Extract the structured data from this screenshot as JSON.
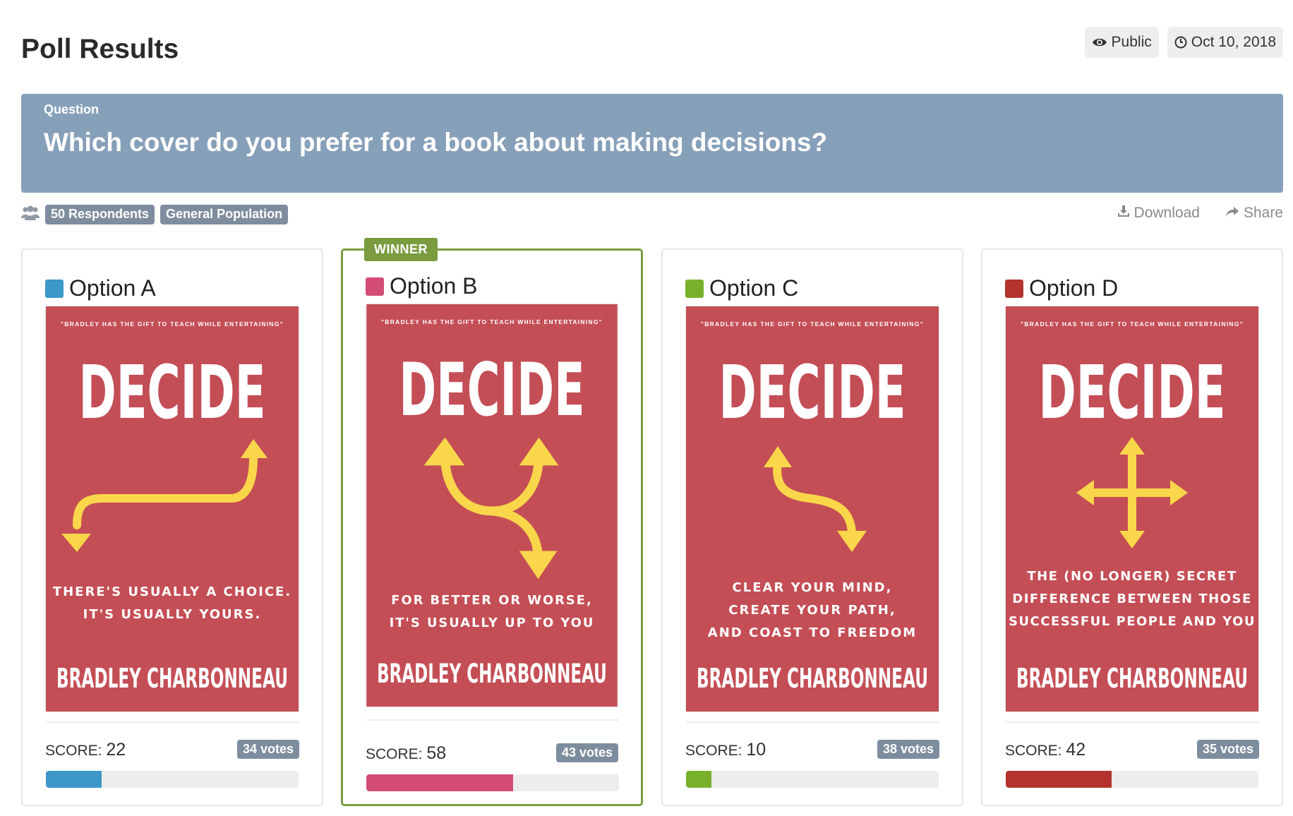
{
  "header": {
    "title": "Poll Results",
    "visibility": "Public",
    "date": "Oct 10, 2018"
  },
  "question": {
    "label": "Question",
    "text": "Which cover do you prefer for a book about making decisions?"
  },
  "meta": {
    "respondents": "50 Respondents",
    "audience": "General Population",
    "download": "Download",
    "share": "Share"
  },
  "score_label": "SCORE:",
  "winner_label": "WINNER",
  "options": [
    {
      "label": "Option A",
      "color": "#3d97c8",
      "score": 22,
      "score_fraction": 0.22,
      "votes": "34 votes",
      "winner": false,
      "cover": {
        "blurb": "\"BRADLEY HAS THE GIFT TO TEACH WHILE ENTERTAINING\"",
        "title": "DECIDE",
        "tagline": [
          "THERE'S USUALLY A CHOICE.",
          "IT'S USUALLY YOURS."
        ],
        "author": "BRADLEY CHARBONNEAU",
        "arrow": "curve-two-way-icon"
      }
    },
    {
      "label": "Option B",
      "color": "#d44d76",
      "score": 58,
      "score_fraction": 0.58,
      "votes": "43 votes",
      "winner": true,
      "cover": {
        "blurb": "\"BRADLEY HAS THE GIFT TO TEACH WHILE ENTERTAINING\"",
        "title": "DECIDE",
        "tagline": [
          "FOR BETTER OR WORSE,",
          "IT'S USUALLY UP TO YOU"
        ],
        "author": "BRADLEY CHARBONNEAU",
        "arrow": "three-way-fork-icon"
      }
    },
    {
      "label": "Option C",
      "color": "#78b02c",
      "score": 10,
      "score_fraction": 0.1,
      "votes": "38 votes",
      "winner": false,
      "cover": {
        "blurb": "\"BRADLEY HAS THE GIFT TO TEACH WHILE ENTERTAINING\"",
        "title": "DECIDE",
        "tagline": [
          "CLEAR YOUR MIND,",
          "CREATE YOUR PATH,",
          "AND COAST TO FREEDOM"
        ],
        "author": "BRADLEY CHARBONNEAU",
        "arrow": "s-curve-icon"
      }
    },
    {
      "label": "Option D",
      "color": "#b3342e",
      "score": 42,
      "score_fraction": 0.42,
      "votes": "35 votes",
      "winner": false,
      "cover": {
        "blurb": "\"BRADLEY HAS THE GIFT TO TEACH WHILE ENTERTAINING\"",
        "title": "DECIDE",
        "tagline": [
          "THE (NO LONGER) SECRET",
          "DIFFERENCE BETWEEN THOSE",
          "SUCCESSFUL PEOPLE AND YOU"
        ],
        "author": "BRADLEY CHARBONNEAU",
        "arrow": "four-way-cross-icon"
      }
    }
  ],
  "colors": {
    "cover_bg": "#c44e56",
    "arrow": "#f9d64a",
    "winner_border": "#7a9b3f",
    "question_bg": "#87a0b9",
    "badge_bg": "#7e8d9e"
  }
}
